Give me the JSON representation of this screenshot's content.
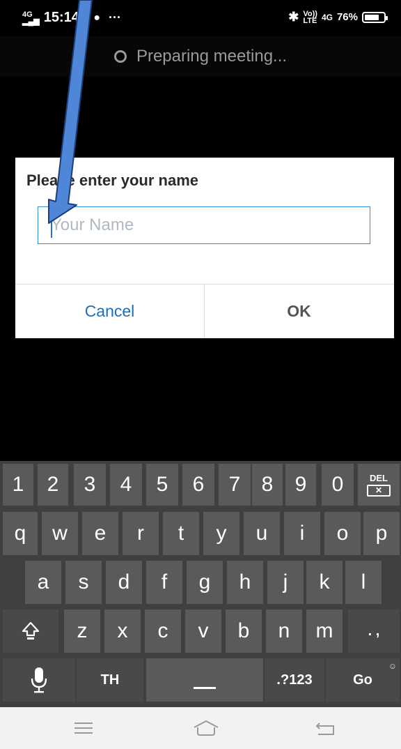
{
  "status_bar": {
    "network": "4G",
    "time": "15:14",
    "right_text": "76%",
    "right_net_top": "Vo))",
    "right_net_bottom": "LTE",
    "right_4g": "4G",
    "battery_level": 0.76
  },
  "preparing": {
    "text": "Preparing meeting..."
  },
  "dialog": {
    "title": "Please enter your name",
    "input_placeholder": "Your Name",
    "input_value": "",
    "cancel_label": "Cancel",
    "ok_label": "OK"
  },
  "keyboard": {
    "rows": [
      [
        "1",
        "2",
        "3",
        "4",
        "5",
        "6",
        "7",
        "8",
        "9",
        "0",
        "DEL"
      ],
      [
        "q",
        "w",
        "e",
        "r",
        "t",
        "y",
        "u",
        "i",
        "o",
        "p"
      ],
      [
        "a",
        "s",
        "d",
        "f",
        "g",
        "h",
        "j",
        "k",
        "l"
      ],
      [
        "shift",
        "z",
        "x",
        "c",
        "v",
        "b",
        "n",
        "m",
        ". ,"
      ],
      [
        "mic",
        "TH",
        "space",
        ".?123",
        "Go"
      ]
    ],
    "del_label": "DEL",
    "comma_label": ". ,",
    "lang_label": "TH",
    "symbols_label": ".?123",
    "go_label": "Go"
  },
  "nav_bar": {
    "icons": [
      "menu-icon",
      "home-icon",
      "back-icon"
    ]
  },
  "annotation": {
    "color": "#4f86d8"
  }
}
